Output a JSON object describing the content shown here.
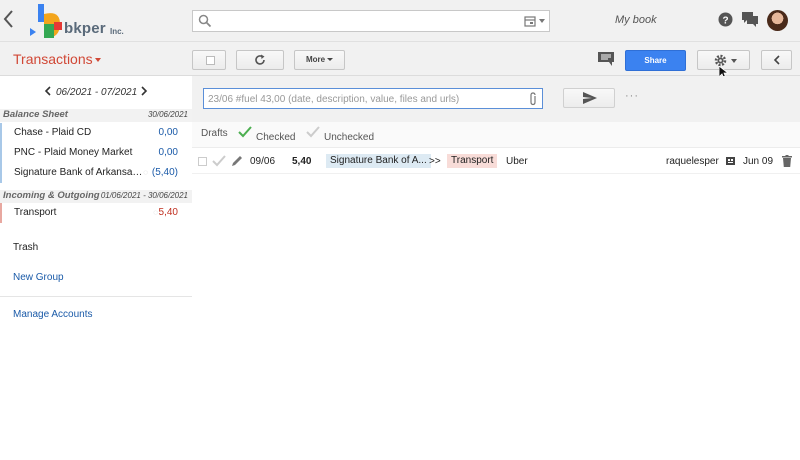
{
  "header": {
    "logo_word": "bkper",
    "logo_suffix": "Inc.",
    "book_name": "My book"
  },
  "toolbar": {
    "section_title": "Transactions",
    "more_label": "More",
    "share_label": "Share"
  },
  "sidebar": {
    "period": "06/2021 - 07/2021",
    "balance_sheet": {
      "name": "Balance Sheet",
      "date": "30/06/2021",
      "accounts": [
        {
          "name": "Chase - Plaid CD",
          "balance": "0,00"
        },
        {
          "name": "PNC - Plaid Money Market",
          "balance": "0,00"
        },
        {
          "name": "Signature Bank of Arkansa…",
          "balance": "(5,40)"
        }
      ]
    },
    "incoming_outgoing": {
      "name": "Incoming & Outgoing",
      "date": "01/06/2021 - 30/06/2021",
      "accounts": [
        {
          "name": "Transport",
          "balance": "5,40"
        }
      ]
    },
    "trash": "Trash",
    "new_group": "New Group",
    "manage_accounts": "Manage Accounts"
  },
  "composer": {
    "placeholder": "23/06 #fuel 43,00 (date, description, value, files and urls)"
  },
  "filters": {
    "drafts": "Drafts",
    "checked": "Checked",
    "unchecked": "Unchecked"
  },
  "transactions": [
    {
      "date": "09/06",
      "amount": "5,40",
      "from": "Signature Bank of A...",
      "arrow": ">>",
      "to": "Transport",
      "description": "Uber",
      "user": "raquelesper",
      "posted": "Jun 09"
    }
  ],
  "colors": {
    "accent": "#d14836",
    "share": "#3b82f0",
    "positive_balance": "#1a5aa8",
    "negative_balance": "#c03020"
  }
}
